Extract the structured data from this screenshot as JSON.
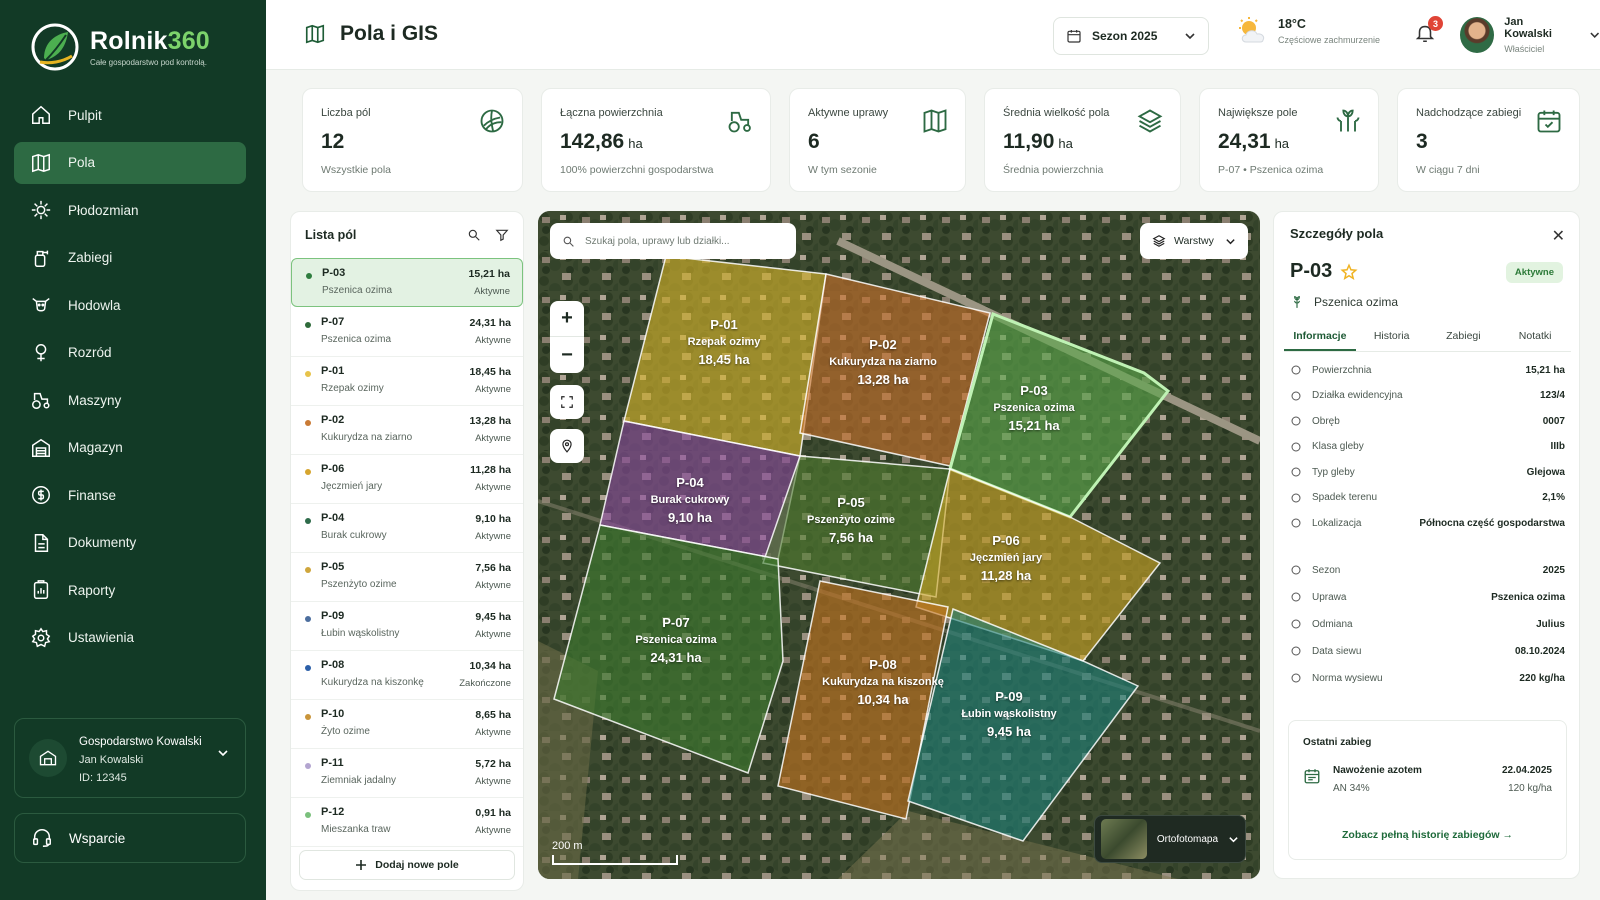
{
  "app": {
    "name": "Rolnik",
    "name_num": "360",
    "tagline": "Całe gospodarstwo pod kontrolą."
  },
  "colors": {
    "sidebar": "#123a26",
    "accent": "#2d6a43",
    "active_bg": "#e3f2e3"
  },
  "nav": [
    {
      "label": "Pulpit",
      "icon": "home-icon"
    },
    {
      "label": "Pola",
      "icon": "map-icon",
      "active": true
    },
    {
      "label": "Płodozmian",
      "icon": "rotation-icon"
    },
    {
      "label": "Zabiegi",
      "icon": "spray-icon"
    },
    {
      "label": "Hodowla",
      "icon": "cow-icon"
    },
    {
      "label": "Rozród",
      "icon": "reproduction-icon"
    },
    {
      "label": "Maszyny",
      "icon": "tractor-icon"
    },
    {
      "label": "Magazyn",
      "icon": "warehouse-icon"
    },
    {
      "label": "Finanse",
      "icon": "money-icon"
    },
    {
      "label": "Dokumenty",
      "icon": "document-icon"
    },
    {
      "label": "Raporty",
      "icon": "report-icon"
    },
    {
      "label": "Ustawienia",
      "icon": "gear-icon"
    }
  ],
  "farm": {
    "name": "Gospodarstwo Kowalski",
    "owner": "Jan Kowalski",
    "id": "ID: 12345"
  },
  "support": "Wsparcie",
  "header": {
    "title": "Pola i GIS",
    "season": "Sezon 2025",
    "weather": {
      "temp": "18°C",
      "desc": "Częściowe zachmurzenie"
    },
    "notifications": "3",
    "user": {
      "name": "Jan Kowalski",
      "role": "Właściciel"
    }
  },
  "stats": [
    {
      "label": "Liczba pól",
      "value": "12",
      "unit": "",
      "sub": "Wszystkie pola",
      "icon": "field-icon"
    },
    {
      "label": "Łączna powierzchnia",
      "value": "142,86",
      "unit": "ha",
      "sub": "100% powierzchni gospodarstwa",
      "icon": "tractor-icon"
    },
    {
      "label": "Aktywne uprawy",
      "value": "6",
      "unit": "",
      "sub": "W tym sezonie",
      "icon": "map-icon"
    },
    {
      "label": "Średnia wielkość pola",
      "value": "11,90",
      "unit": "ha",
      "sub": "Średnia powierzchnia",
      "icon": "layers-icon"
    },
    {
      "label": "Największe pole",
      "value": "24,31",
      "unit": "ha",
      "sub": "P-07 • Pszenica ozima",
      "icon": "wheat-icon"
    },
    {
      "label": "Nadchodzące zabiegi",
      "value": "3",
      "unit": "",
      "sub": "W ciągu 7 dni",
      "icon": "calendar-icon"
    }
  ],
  "list": {
    "title": "Lista pól",
    "add_label": "Dodaj nowe pole",
    "fields": [
      {
        "id": "P-03",
        "crop": "Pszenica ozima",
        "area": "15,21 ha",
        "status": "Aktywne",
        "color": "#2e7d3e",
        "active": true
      },
      {
        "id": "P-07",
        "crop": "Pszenica ozima",
        "area": "24,31 ha",
        "status": "Aktywne",
        "color": "#2e6b3a"
      },
      {
        "id": "P-01",
        "crop": "Rzepak ozimy",
        "area": "18,45 ha",
        "status": "Aktywne",
        "color": "#e7c34a"
      },
      {
        "id": "P-02",
        "crop": "Kukurydza na ziarno",
        "area": "13,28 ha",
        "status": "Aktywne",
        "color": "#c97a35"
      },
      {
        "id": "P-06",
        "crop": "Jęczmień jary",
        "area": "11,28 ha",
        "status": "Aktywne",
        "color": "#d6a52e"
      },
      {
        "id": "P-04",
        "crop": "Burak cukrowy",
        "area": "9,10 ha",
        "status": "Aktywne",
        "color": "#2e6b4a"
      },
      {
        "id": "P-05",
        "crop": "Pszenżyto ozime",
        "area": "7,56 ha",
        "status": "Aktywne",
        "color": "#cfa63c"
      },
      {
        "id": "P-09",
        "crop": "Łubin wąskolistny",
        "area": "9,45 ha",
        "status": "Aktywne",
        "color": "#4c6e9e"
      },
      {
        "id": "P-08",
        "crop": "Kukurydza na kiszonkę",
        "area": "10,34 ha",
        "status": "Zakończone",
        "color": "#2c5fa8"
      },
      {
        "id": "P-10",
        "crop": "Żyto ozime",
        "area": "8,65 ha",
        "status": "Aktywne",
        "color": "#c9953a"
      },
      {
        "id": "P-11",
        "crop": "Ziemniak jadalny",
        "area": "5,72 ha",
        "status": "Aktywne",
        "color": "#b3a5d0"
      },
      {
        "id": "P-12",
        "crop": "Mieszanka traw",
        "area": "0,91 ha",
        "status": "Aktywne",
        "color": "#7ac07c"
      }
    ]
  },
  "map": {
    "search_placeholder": "Szukaj pola, uprawy lub działki...",
    "layers_label": "Warstwy",
    "scale_label": "200 m",
    "basemap_label": "Ortofotomapa",
    "fields": [
      {
        "id": "P-01",
        "crop": "Rzepak ozimy",
        "area": "18,45 ha",
        "color": "#d6b52a"
      },
      {
        "id": "P-02",
        "crop": "Kukurydza na ziarno",
        "area": "13,28 ha",
        "color": "#c8702a"
      },
      {
        "id": "P-03",
        "crop": "Pszenica ozima",
        "area": "15,21 ha",
        "color": "#5aa64a"
      },
      {
        "id": "P-04",
        "crop": "Burak cukrowy",
        "area": "9,10 ha",
        "color": "#8a4a9e"
      },
      {
        "id": "P-05",
        "crop": "Pszenżyto ozime",
        "area": "7,56 ha",
        "color": "#4f7a2e"
      },
      {
        "id": "P-06",
        "crop": "Jęczmień jary",
        "area": "11,28 ha",
        "color": "#c9a324"
      },
      {
        "id": "P-07",
        "crop": "Pszenica ozima",
        "area": "24,31 ha",
        "color": "#3e7a2e"
      },
      {
        "id": "P-08",
        "crop": "Kukurydza na kiszonkę",
        "area": "10,34 ha",
        "color": "#c4721e"
      },
      {
        "id": "P-09",
        "crop": "Łubin wąskolistny",
        "area": "9,45 ha",
        "color": "#1f7f78"
      }
    ]
  },
  "details": {
    "title": "Szczegóły pola",
    "id": "P-03",
    "status": "Aktywne",
    "crop": "Pszenica ozima",
    "tabs": [
      "Informacje",
      "Historia",
      "Zabiegi",
      "Notatki"
    ],
    "info": [
      {
        "label": "Powierzchnia",
        "value": "15,21 ha",
        "icon": "area-icon"
      },
      {
        "label": "Działka ewidencyjna",
        "value": "123/4",
        "icon": "parcel-icon"
      },
      {
        "label": "Obręb",
        "value": "0007",
        "icon": "district-icon"
      },
      {
        "label": "Klasa gleby",
        "value": "IIIb",
        "icon": "soil-class-icon"
      },
      {
        "label": "Typ gleby",
        "value": "Glejowa",
        "icon": "soil-type-icon"
      },
      {
        "label": "Spadek terenu",
        "value": "2,1%",
        "icon": "slope-icon"
      },
      {
        "label": "Lokalizacja",
        "value": "Północna część gospodarstwa",
        "icon": "location-icon"
      }
    ],
    "season_info": [
      {
        "label": "Sezon",
        "value": "2025",
        "icon": "calendar-icon"
      },
      {
        "label": "Uprawa",
        "value": "Pszenica ozima",
        "icon": "wheat-icon"
      },
      {
        "label": "Odmiana",
        "value": "Julius",
        "icon": "variety-icon"
      },
      {
        "label": "Data siewu",
        "value": "08.10.2024",
        "icon": "calendar-icon"
      },
      {
        "label": "Norma wysiewu",
        "value": "220 kg/ha",
        "icon": "seed-icon"
      }
    ],
    "last": {
      "title": "Ostatni zabieg",
      "name": "Nawożenie azotem",
      "dose": "AN 34%",
      "date": "22.04.2025",
      "rate": "120 kg/ha",
      "link": "Zobacz pełną historię zabiegów"
    }
  }
}
